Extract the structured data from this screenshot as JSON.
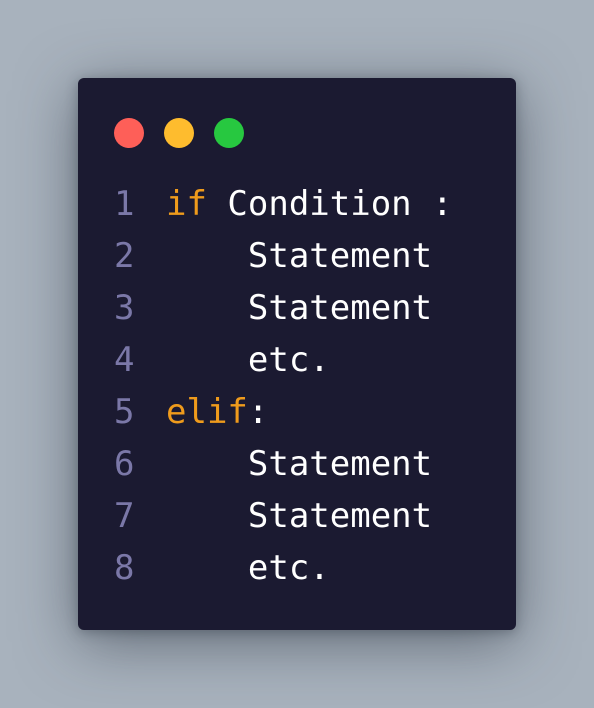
{
  "window": {
    "controls": {
      "close_color": "#fe5f58",
      "minimize_color": "#febc2e",
      "maximize_color": "#27c840"
    }
  },
  "colors": {
    "background": "#a8b2bd",
    "editor_background": "#1b1a31",
    "line_number": "#7b78a8",
    "keyword": "#ef9b1c",
    "text": "#ffffff"
  },
  "code": {
    "lines": [
      {
        "number": "1",
        "indent": "",
        "keyword": "if",
        "text": " Condition :"
      },
      {
        "number": "2",
        "indent": "    ",
        "keyword": "",
        "text": "Statement"
      },
      {
        "number": "3",
        "indent": "    ",
        "keyword": "",
        "text": "Statement"
      },
      {
        "number": "4",
        "indent": "    ",
        "keyword": "",
        "text": "etc."
      },
      {
        "number": "5",
        "indent": "",
        "keyword": "elif",
        "text": ":"
      },
      {
        "number": "6",
        "indent": "    ",
        "keyword": "",
        "text": "Statement"
      },
      {
        "number": "7",
        "indent": "    ",
        "keyword": "",
        "text": "Statement"
      },
      {
        "number": "8",
        "indent": "    ",
        "keyword": "",
        "text": "etc."
      }
    ]
  }
}
